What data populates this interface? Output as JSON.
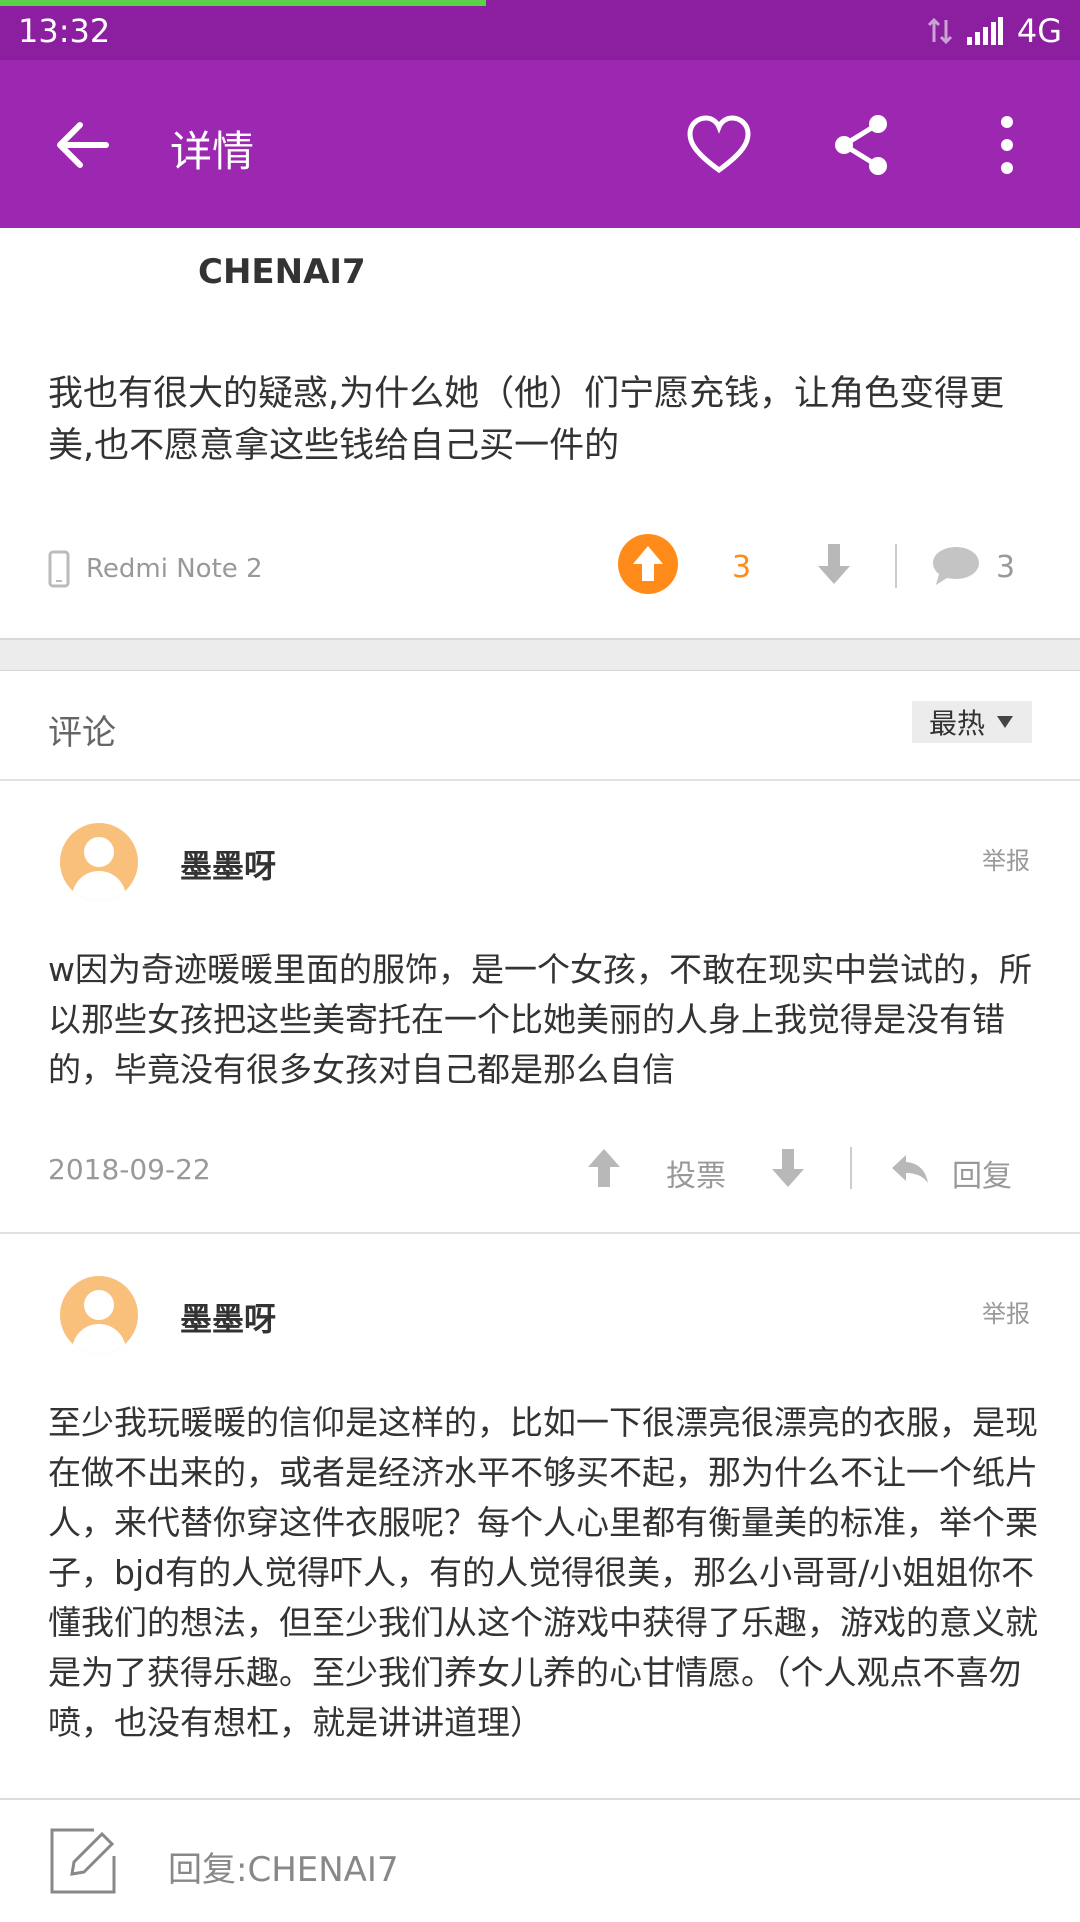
{
  "status": {
    "time": "13:32",
    "network": "4G"
  },
  "page_load_progress": 0.45,
  "appbar": {
    "title": "详情"
  },
  "post": {
    "author": "CHENAI7",
    "content": "我也有很大的疑惑,为什么她（他）们宁愿充钱，让角色变得更美,也不愿意拿这些钱给自己买一件的",
    "device": "Redmi Note 2",
    "votes": "3",
    "comments": "3"
  },
  "comments_header": {
    "label": "评论",
    "sort": "最热"
  },
  "comments": [
    {
      "name": "墨墨呀",
      "report": "举报",
      "text": "w因为奇迹暖暖里面的服饰，是一个女孩，不敢在现实中尝试的，所以那些女孩把这些美寄托在一个比她美丽的人身上我觉得是没有错的，毕竟没有很多女孩对自己都是那么自信",
      "date": "2018-09-22",
      "vote_label": "投票",
      "reply_label": "回复"
    },
    {
      "name": "墨墨呀",
      "report": "举报",
      "text": "至少我玩暖暖的信仰是这样的，比如一下很漂亮很漂亮的衣服，是现在做不出来的，或者是经济水平不够买不起，那为什么不让一个纸片人，来代替你穿这件衣服呢？每个人心里都有衡量美的标准，举个栗子，bjd有的人觉得吓人，有的人觉得很美，那么小哥哥/小姐姐你不懂我们的想法，但至少我们从这个游戏中获得了乐趣，游戏的意义就是为了获得乐趣。至少我们养女儿养的心甘情愿。（个人观点不喜勿喷，也没有想杠，就是讲讲道理）"
    }
  ],
  "reply_bar": {
    "placeholder": "回复:CHENAI7"
  },
  "colors": {
    "primary": "#9c27b0",
    "status": "#8b1fa0",
    "accent": "#ff8c1a"
  }
}
